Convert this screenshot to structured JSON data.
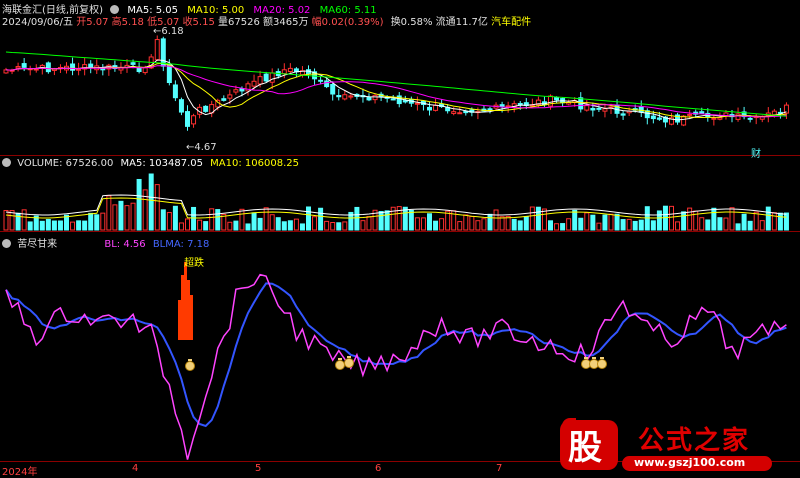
{
  "header": {
    "stock_name": "海联金汇(日线,前复权)",
    "ma5": "MA5: 5.05",
    "ma10": "MA10: 5.00",
    "ma20": "MA20: 5.02",
    "ma60": "MA60: 5.11",
    "date": "2024/09/06/五",
    "open": "开5.07",
    "high": "高5.18",
    "low": "低5.07",
    "close": "收5.15",
    "volume": "量67526",
    "amount": "额3465万",
    "change": "幅0.02(0.39%)",
    "turnover": "换0.58%",
    "float": "流通11.7亿",
    "sector": "汽车配件",
    "colors": {
      "ma5": "#ffffff",
      "ma10": "#ffff00",
      "ma20": "#ff00ff",
      "ma60": "#00ff00",
      "up": "#ff3030",
      "down": "#54ffff"
    }
  },
  "price_panel": {
    "high_label": "6.18",
    "low_label": "4.67",
    "marker": "财"
  },
  "volume_panel": {
    "title": "VOLUME: 67526.00",
    "ma5": "MA5: 103487.05",
    "ma10": "MA10: 106008.25"
  },
  "indicator_panel": {
    "title": "苦尽甘来",
    "bl": "BL: 4.56",
    "blma": "BLMA: 7.18",
    "bar_label": "超跌",
    "signal_icon": "money-bag-icon"
  },
  "x_axis": {
    "labels": [
      "2024年",
      "4",
      "5",
      "6",
      "7"
    ]
  },
  "watermark": {
    "char": "股",
    "title": "公式之家",
    "url": "www.gszj100.com"
  }
}
